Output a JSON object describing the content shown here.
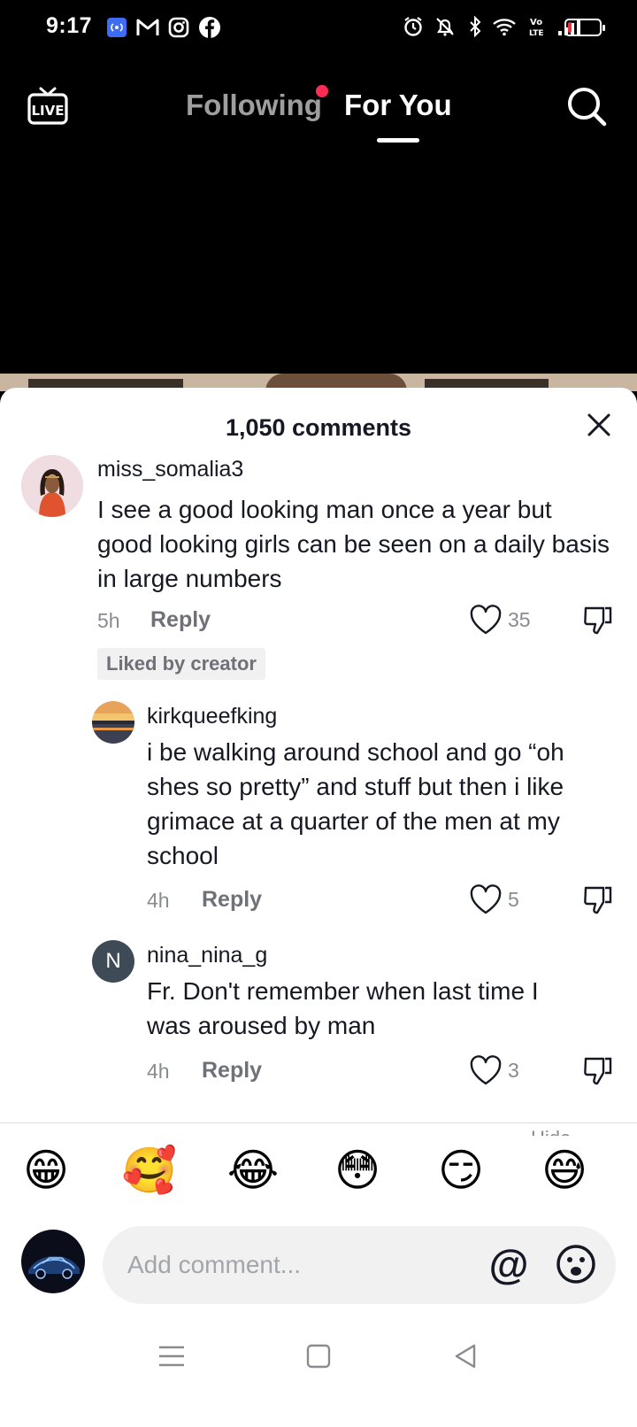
{
  "status_bar": {
    "time": "9:17",
    "battery_level": 0.12,
    "battery_color": "#e8323c"
  },
  "top_nav": {
    "live_label": "LIVE",
    "tab_following": "Following",
    "tab_for_you": "For You",
    "active_tab": "For You",
    "notification_dot_color": "#fe2c55"
  },
  "comments_sheet": {
    "title": "1,050 comments",
    "comments": [
      {
        "username": "miss_somalia3",
        "text": "I see a good looking man once a year but good looking girls can be seen on a daily basis in large numbers",
        "time": "5h",
        "reply_label": "Reply",
        "likes": "35",
        "liked_by_creator": "Liked by creator"
      },
      {
        "username": "kirkqueefking",
        "text": "i be walking around school and go “oh shes so pretty” and stuff but then i like grimace at a quarter of the men at my school",
        "time": "4h",
        "reply_label": "Reply",
        "likes": "5"
      },
      {
        "username": "nina_nina_g",
        "avatar_letter": "N",
        "text": "Fr. Don't remember when last time I was aroused by man",
        "time": "4h",
        "reply_label": "Reply",
        "likes": "3"
      }
    ],
    "hide_hint": "Hide"
  },
  "emoji_bar": [
    "😁",
    "🥰",
    "😂",
    "😳",
    "😏",
    "😅"
  ],
  "comment_input": {
    "placeholder": "Add comment...",
    "at_label": "@"
  }
}
